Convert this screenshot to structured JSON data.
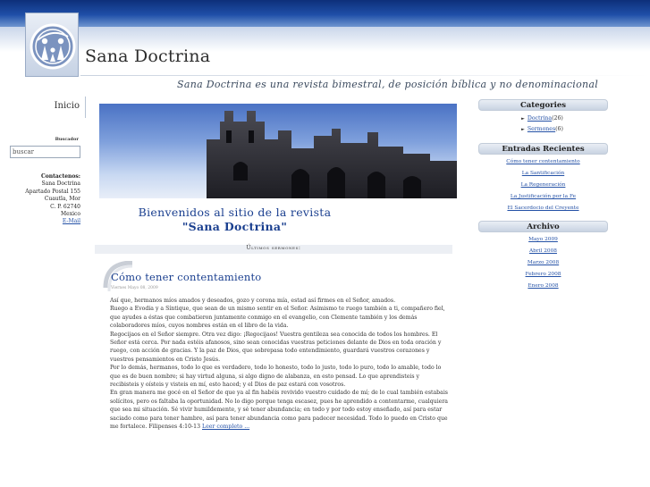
{
  "header": {
    "site_title": "Sana Doctrina",
    "tagline": "Sana Doctrina es una revista bimestral, de posición bíblica y no denominacional"
  },
  "left": {
    "nav_inicio": "Inicio",
    "search_label": "Buscador",
    "search_value": "buscar",
    "contact_title": "Contactenos:",
    "contact_lines": [
      "Sana Doctrina",
      "Apartado Postal 155",
      "Cuautla, Mor",
      "C. P. 62740",
      "Mexico"
    ],
    "email_link": "E-Mail"
  },
  "main": {
    "welcome_line1": "Bienvenidos al sitio de la revista",
    "welcome_line2": "\"Sana Doctrina\"",
    "ultimos_header": "Últimos sermones:",
    "post": {
      "title": "Cómo tener contentamiento",
      "meta": "Viernes Mayo 08, 2009",
      "paragraphs": [
        "Así que, hermanos míos amados y deseados, gozo y corona mía, estad así firmes en el Señor, amados.",
        "Ruego a Evodia y a Síntique, que sean de un mismo sentir en el Señor. Asimismo te ruego también a ti, compañero fiel, que ayudes a éstas que combatieron juntamente conmigo en el evangelio, con Clemente también y los demás colaboradores míos, cuyos nombres están en el libro de la vida.",
        "Regocijaos en el Señor siempre. Otra vez digo: ¡Regocijaos! Vuestra gentileza sea conocida de todos los hombres. El Señor está cerca. Por nada estéis afanosos, sino sean conocidas vuestras peticiones delante de Dios en toda oración y ruego, con acción de gracias. Y la paz de Dios, que sobrepasa todo entendimiento, guardará vuestros corazones y vuestros pensamientos en Cristo Jesús.",
        "Por lo demás, hermanos, todo lo que es verdadero, todo lo honesto, todo lo justo, todo lo puro, todo lo amable, todo lo que es de buen nombre; si hay virtud alguna, si algo digno de alabanza, en esto pensad. Lo que aprendisteis y recibisteis y oísteis y visteis en mí, esto haced; y el Dios de paz estará con vosotros."
      ],
      "last_paragraph": "En gran manera me gocé en el Señor de que ya al fin habéis revivido vuestro cuidado de mí; de lo cual también estabais solícitos, pero os faltaba la oportunidad. No lo digo porque tenga escasez, pues he aprendido a contentarme, cualquiera que sea mi situación. Sé vivir humildemente, y sé tener abundancia; en todo y por todo estoy enseñado, así para estar saciado como para tener hambre, así para tener abundancia como para padecer necesidad. Todo lo puedo en Cristo que me fortalece. Filipenses 4:10-13",
      "read_more": "Leer completo ..."
    }
  },
  "sidebar": {
    "categories_title": "Categories",
    "categories": [
      {
        "label": "Doctrina",
        "count": "(26)"
      },
      {
        "label": "Sermones",
        "count": "(6)"
      }
    ],
    "recent_title": "Entradas Recientes",
    "recent": [
      "Cómo tener contentamiento",
      "La Santificación",
      "La Regeneración",
      "La Justificación por la Fe",
      "El Sacerdocio del Creyente"
    ],
    "archive_title": "Archivo",
    "archive": [
      "Mayo 2009",
      "Abril 2008",
      "Marzo 2008",
      "Febrero 2008",
      "Enero 2008"
    ]
  },
  "icons": {
    "logo": "family-logo-icon",
    "category_bullet": "arrow-right-icon"
  },
  "colors": {
    "topbar": "#1f4fa8",
    "link": "#2451a6",
    "heading": "#1a3f8f"
  }
}
